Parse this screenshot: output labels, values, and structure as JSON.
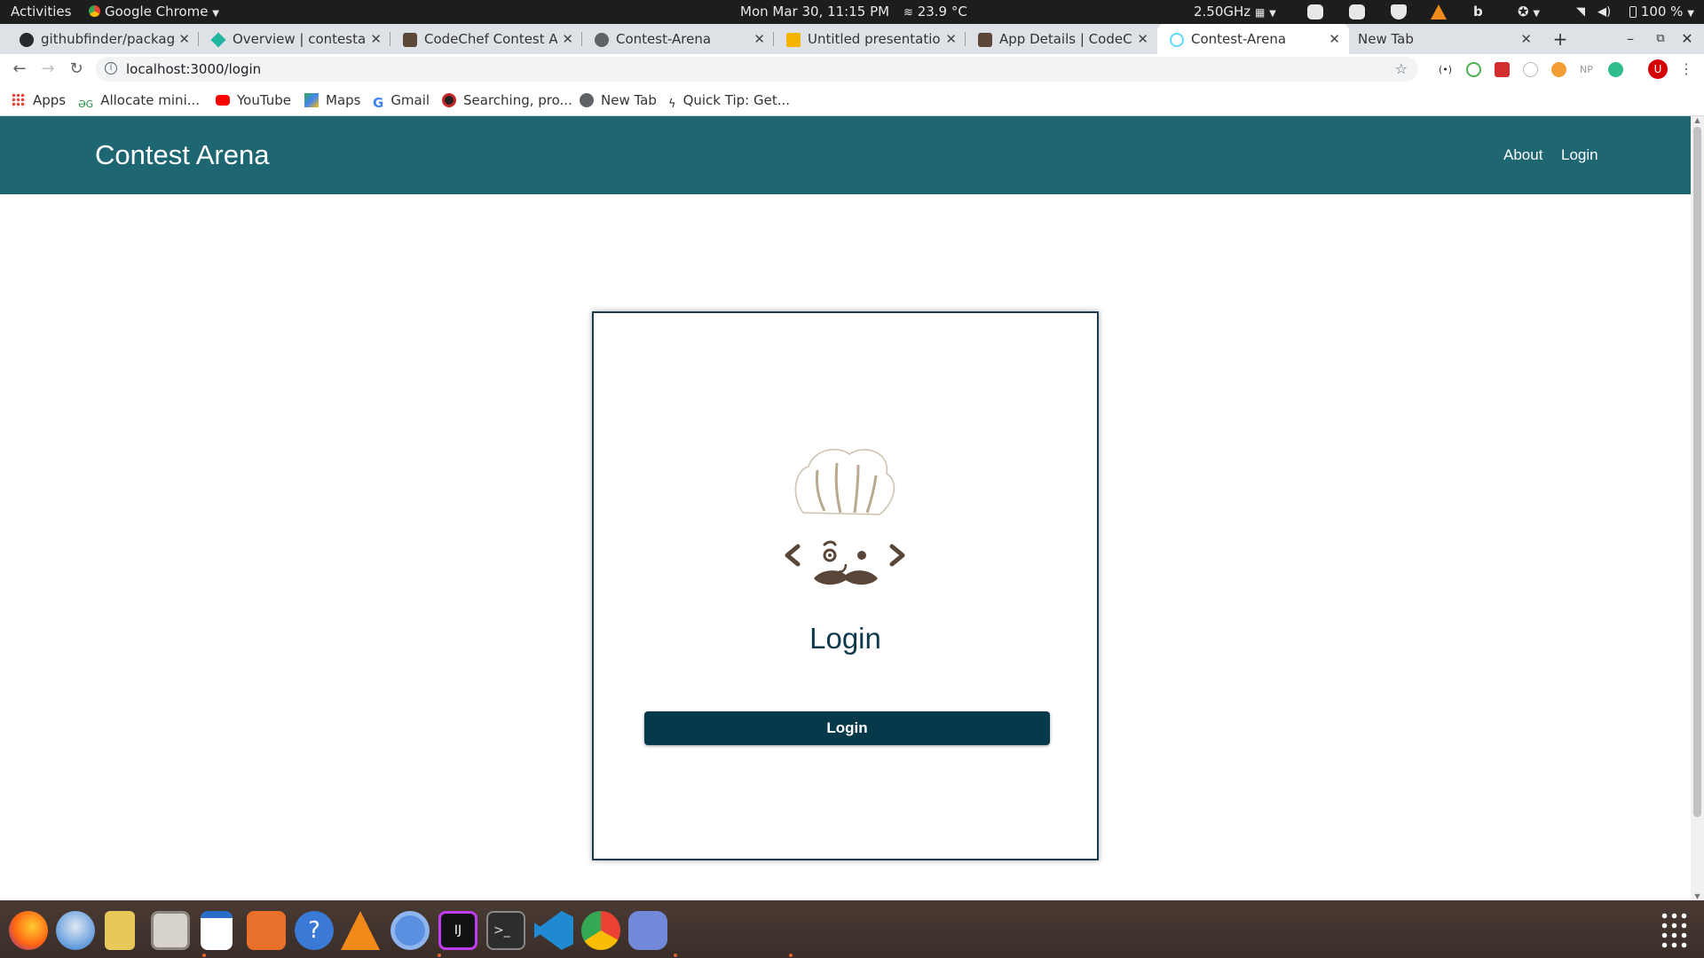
{
  "system_bar": {
    "activities": "Activities",
    "app_menu": "Google Chrome",
    "datetime": "Mon Mar 30, 11:15 PM",
    "weather": "23.9 °C",
    "cpu": "2.50GHz",
    "battery": "100 %"
  },
  "tabs": [
    {
      "title": "githubfinder/package",
      "icon": "github-icon",
      "active": false
    },
    {
      "title": "Overview | contestare",
      "icon": "diamond-icon",
      "active": false
    },
    {
      "title": "CodeChef Contest Are",
      "icon": "codechef-icon",
      "active": false
    },
    {
      "title": "Contest-Arena",
      "icon": "globe-icon",
      "active": false
    },
    {
      "title": "Untitled presentation",
      "icon": "slides-icon",
      "active": false
    },
    {
      "title": "App Details | CodeChe",
      "icon": "codechef-icon",
      "active": false
    },
    {
      "title": "Contest-Arena",
      "icon": "react-icon",
      "active": true
    },
    {
      "title": "New Tab",
      "icon": "",
      "active": false
    }
  ],
  "address_bar": {
    "url": "localhost:3000/login"
  },
  "bookmarks": [
    {
      "label": "Apps",
      "icon": "apps-grid-icon"
    },
    {
      "label": "Allocate mini...",
      "icon": "allocate-icon"
    },
    {
      "label": "YouTube",
      "icon": "youtube-icon"
    },
    {
      "label": "Maps",
      "icon": "maps-icon"
    },
    {
      "label": "Gmail",
      "icon": "google-icon"
    },
    {
      "label": "Searching, pro...",
      "icon": "search-site-icon"
    },
    {
      "label": "New Tab",
      "icon": "globe-icon"
    },
    {
      "label": "Quick Tip: Get...",
      "icon": "quicktip-icon"
    }
  ],
  "page": {
    "brand": "Contest Arena",
    "nav": {
      "about": "About",
      "login": "Login"
    },
    "card": {
      "title": "Login",
      "button_label": "Login"
    }
  },
  "colors": {
    "navbar": "#1d6672",
    "button": "#06394a",
    "title": "#0d3a4d"
  },
  "dock_apps": [
    "Firefox",
    "Thunderbird",
    "Rhythmbox",
    "Files",
    "LibreOffice Writer",
    "Ubuntu Software",
    "Help",
    "VLC",
    "Chromium",
    "IntelliJ IDEA",
    "Terminal",
    "Visual Studio Code",
    "Google Chrome",
    "Discord"
  ]
}
